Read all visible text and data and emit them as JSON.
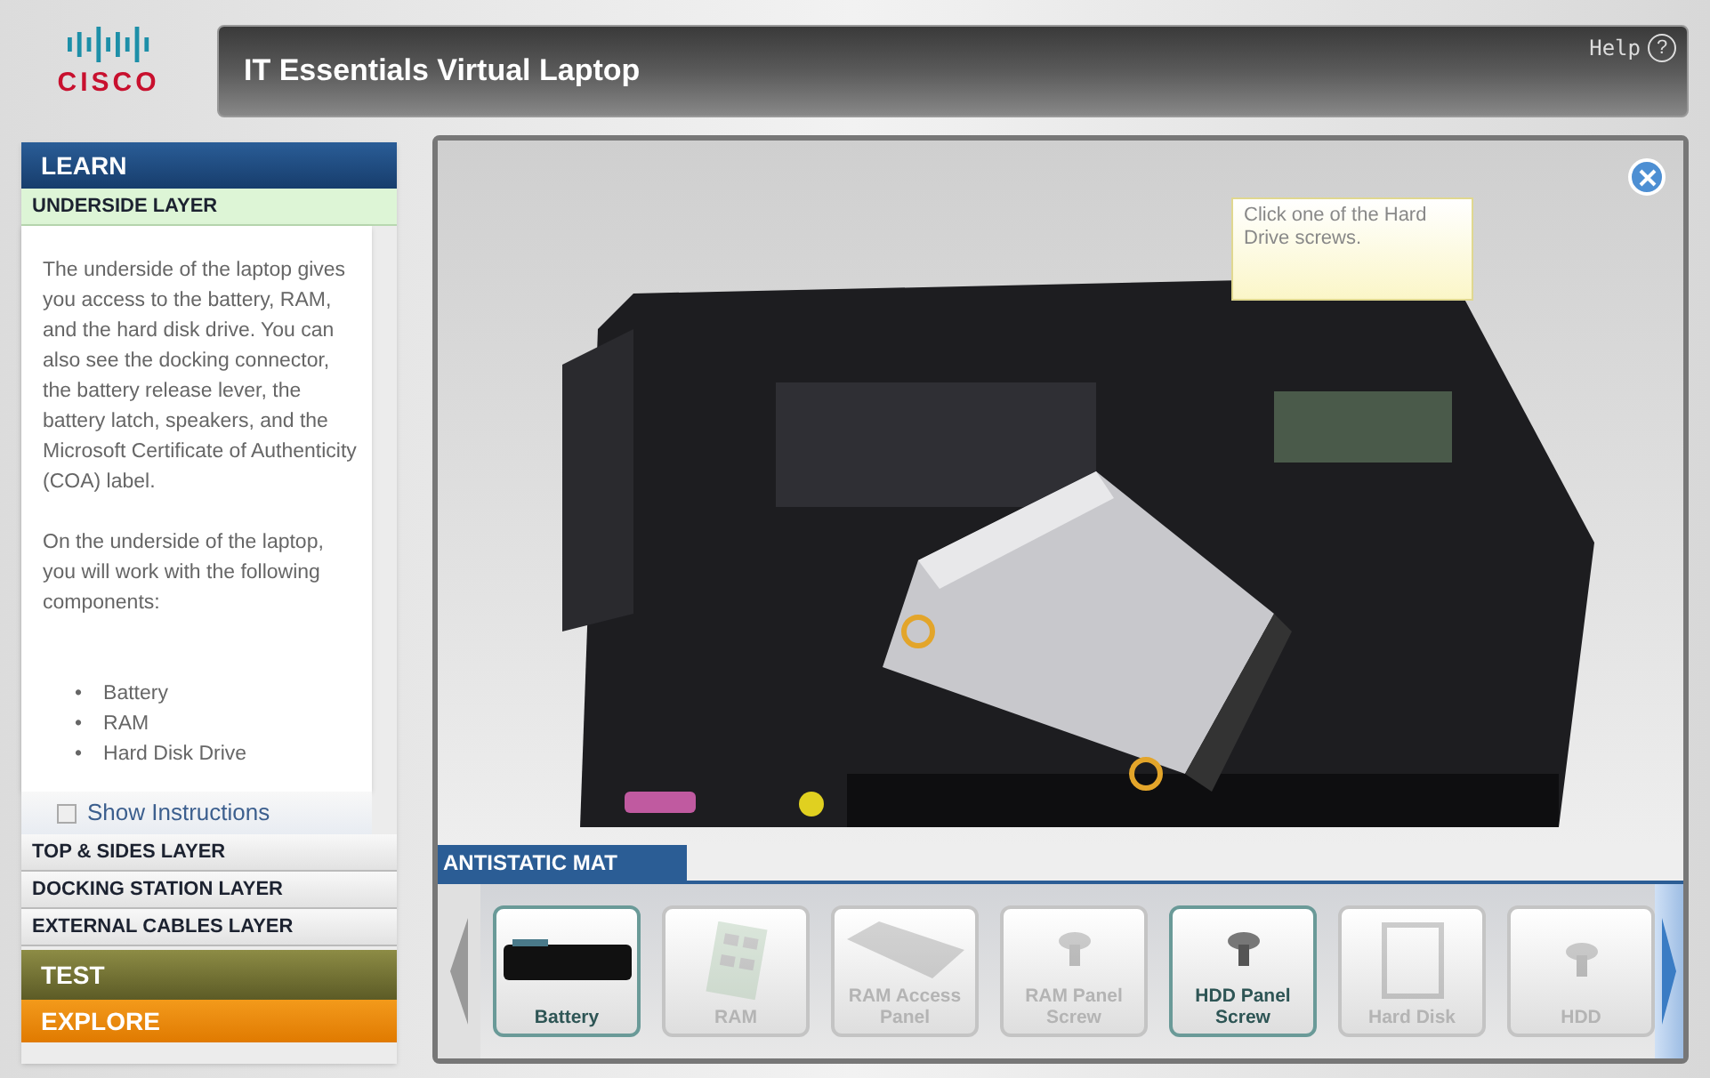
{
  "header": {
    "logo": "CISCO",
    "title": "IT Essentials Virtual Laptop",
    "help": "Help",
    "help_mark": "?"
  },
  "sidebar": {
    "learn": "LEARN",
    "layers": [
      {
        "label": "UNDERSIDE LAYER",
        "selected": true,
        "paragraphs": [
          "The underside of the laptop gives you access to the battery, RAM, and the hard disk drive. You can also see the docking connector, the battery release lever, the battery latch, speakers, and the Microsoft Certificate of Authenticity (COA) label.",
          "On the underside of the laptop, you will work with the following components:"
        ],
        "components": [
          {
            "bullet": "•",
            "label": "Battery"
          },
          {
            "bullet": "•",
            "label": "RAM"
          },
          {
            "bullet": "•",
            "label": "Hard Disk Drive"
          }
        ],
        "show_instructions": {
          "label": "Show Instructions",
          "checked": false
        }
      },
      {
        "label": "TOP & SIDES LAYER",
        "selected": false
      },
      {
        "label": "DOCKING STATION LAYER",
        "selected": false
      },
      {
        "label": "EXTERNAL CABLES LAYER",
        "selected": false
      }
    ],
    "test": "TEST",
    "explore": "EXPLORE"
  },
  "scene": {
    "hint": "Click one of the Hard Drive screws."
  },
  "mat": {
    "title": "ANTISTATIC MAT",
    "items": [
      {
        "label": "Battery",
        "enabled": true,
        "kind": "battery"
      },
      {
        "label": "RAM",
        "enabled": false,
        "kind": "ram"
      },
      {
        "label": "RAM Access Panel",
        "enabled": false,
        "kind": "panel"
      },
      {
        "label": "RAM Panel Screw",
        "enabled": false,
        "kind": "screw"
      },
      {
        "label": "HDD Panel Screw",
        "enabled": true,
        "kind": "screw"
      },
      {
        "label": "Hard Disk",
        "enabled": false,
        "kind": "disk"
      },
      {
        "label": "HDD",
        "enabled": false,
        "kind": "screw"
      }
    ]
  }
}
